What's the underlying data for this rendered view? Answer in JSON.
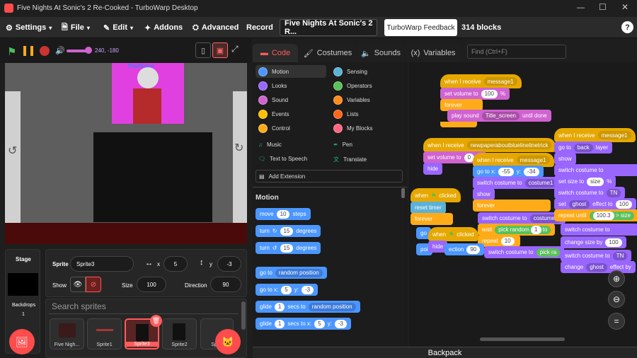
{
  "window": {
    "title": "Five Nights At Sonic's 2 Re-Cooked - TurboWarp Desktop",
    "controls": [
      "minimize",
      "maximize",
      "close"
    ]
  },
  "menubar": {
    "settings": "Settings",
    "file": "File",
    "edit": "Edit",
    "addons": "Addons",
    "advanced": "Advanced",
    "record": "Record",
    "project_title": "Five Nights At Sonic's 2 R...",
    "feedback": "TurboWarp Feedback",
    "blocks_count": "314 blocks",
    "help": "?"
  },
  "stagebar": {
    "coords": "240, -180"
  },
  "stage": {
    "sprite_text": "ThePeace"
  },
  "tabs": {
    "code": "Code",
    "costumes": "Costumes",
    "sounds": "Sounds",
    "variables": "Variables",
    "find_placeholder": "Find (Ctrl+F)"
  },
  "categories": [
    {
      "label": "Motion",
      "color": "#4c97ff"
    },
    {
      "label": "Sensing",
      "color": "#5cb1d6"
    },
    {
      "label": "Looks",
      "color": "#9966ff"
    },
    {
      "label": "Operators",
      "color": "#59c059"
    },
    {
      "label": "Sound",
      "color": "#cf63cf"
    },
    {
      "label": "Variables",
      "color": "#ff8c1a"
    },
    {
      "label": "Events",
      "color": "#ffbf00"
    },
    {
      "label": "Lists",
      "color": "#ff661a"
    },
    {
      "label": "Control",
      "color": "#ffab19"
    },
    {
      "label": "My Blocks",
      "color": "#ff6680"
    },
    {
      "label": "Music",
      "color": "#0fbd8c"
    },
    {
      "label": "Pen",
      "color": "#0fbd8c"
    },
    {
      "label": "Text to Speech",
      "color": "#0fbd8c"
    },
    {
      "label": "Translate",
      "color": "#0fbd8c"
    }
  ],
  "add_extension": "Add Extension",
  "palette": {
    "heading": "Motion",
    "move": "move",
    "move_val": "10",
    "steps": "steps",
    "turn": "turn",
    "turn_right_val": "15",
    "degrees": "degrees",
    "turn_left_val": "15",
    "goto": "go to",
    "goto_opt": "random position",
    "goto_xy": "go to x:",
    "x_val": "5",
    "y_label": "y:",
    "y_val": "-3",
    "glide": "glide",
    "glide_val": "1",
    "secs_to": "secs to",
    "glide_opt": "random position",
    "glide_xy_val": "1",
    "glide_x_label": "secs to x:",
    "glide_x_val": "5",
    "glide_y_val": "-3"
  },
  "sprite_info": {
    "stage_label": "Stage",
    "backdrops_label": "Backdrops",
    "backdrops_count": "1",
    "sprite_label": "Sprite",
    "sprite_name": "Sprite3",
    "x_label": "x",
    "x_val": "5",
    "y_label": "y",
    "y_val": "-3",
    "show_label": "Show",
    "size_label": "Size",
    "size_val": "100",
    "direction_label": "Direction",
    "direction_val": "90",
    "search_placeholder": "Search sprites"
  },
  "sprites": [
    "Five Nigh...",
    "Sprite1",
    "Sprite3",
    "Sprite2",
    "Spr..."
  ],
  "scripts": {
    "s1": {
      "hat": "when I receive",
      "msg": "message1",
      "set_vol": "set volume to",
      "vol": "100",
      "pct": "%",
      "forever": "forever",
      "play": "play sound",
      "sound": "Title_screen",
      "until": "until done"
    },
    "s2": {
      "hat": "when I receive",
      "msg": "newpaperaboutbluelinelinetrick",
      "set_vol": "set volume to",
      "vol": "0",
      "pct": "%",
      "hide": "hide"
    },
    "s3": {
      "hat": "when I receive",
      "msg": "message1",
      "goto": "go to x:",
      "x": "-55",
      "y_label": "y:",
      "y": "-34",
      "switch": "switch costume to",
      "costume": "costume1",
      "show": "show",
      "forever": "forever"
    },
    "s4": {
      "hat": "when",
      "clicked": "clicked",
      "reset": "reset timer",
      "forever": "forever",
      "go": "go",
      "point": "poi",
      "action": "ection",
      "deg": "90"
    },
    "s5": {
      "switch": "switch costume to",
      "costume": "costume1",
      "wait": "wait",
      "pick": "pick random",
      "r1": "1",
      "to": "to",
      "repeat": "repeat",
      "rep": "10",
      "switch2": "switch costume to",
      "pick2": "pick ra",
      "when": "when",
      "clicked": "clicked",
      "hide": "hide"
    },
    "s6": {
      "hat": "when I receive",
      "msg": "message1",
      "goto": "go to",
      "back": "back",
      "layer": "layer",
      "show": "show",
      "switch": "switch costume to",
      "set_size": "set size to",
      "size": "size",
      "pct": "%",
      "switch2": "switch costume to",
      "costume": "TN",
      "set_effect": "set",
      "ghost": "ghost",
      "effect_to": "effect to",
      "eff_val": "100",
      "repeat_until": "repeat until",
      "r_val": "100.3",
      "gt": ">",
      "switch3": "switch costume to",
      "change_size": "change size by",
      "cs_val": "100",
      "switch4": "switch costume to",
      "costume2": "TN",
      "change": "change",
      "ghost2": "ghost",
      "effect_by": "effect by"
    }
  },
  "backpack": "Backpack"
}
